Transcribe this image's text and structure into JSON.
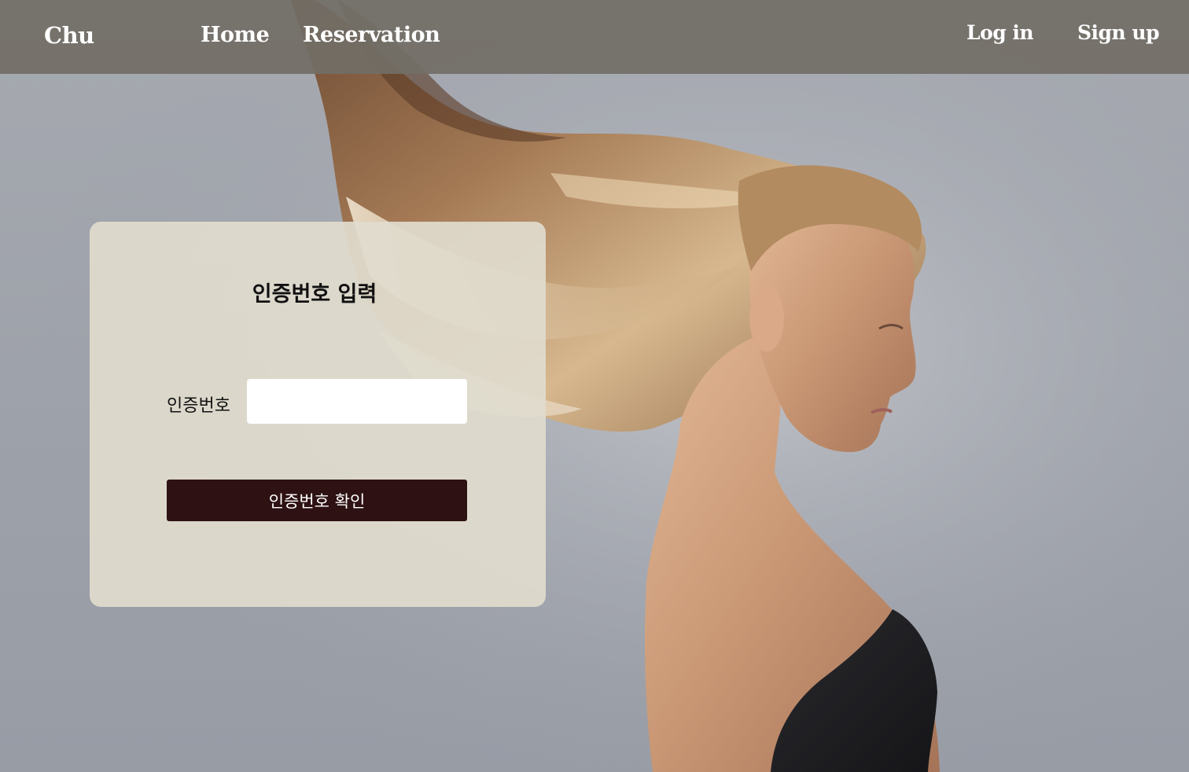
{
  "header": {
    "brand": "Chu",
    "nav": [
      {
        "label": "Home"
      },
      {
        "label": "Reservation"
      }
    ],
    "auth": {
      "login_label": "Log in",
      "signup_label": "Sign up"
    }
  },
  "card": {
    "title": "인증번호 입력",
    "code_label": "인증번호",
    "code_value": "",
    "confirm_label": "인증번호 확인"
  },
  "colors": {
    "header_bg": "#726e66",
    "card_bg": "#e0dbce",
    "button_bg": "#2e1113",
    "page_bg": "#a0a4ab"
  }
}
